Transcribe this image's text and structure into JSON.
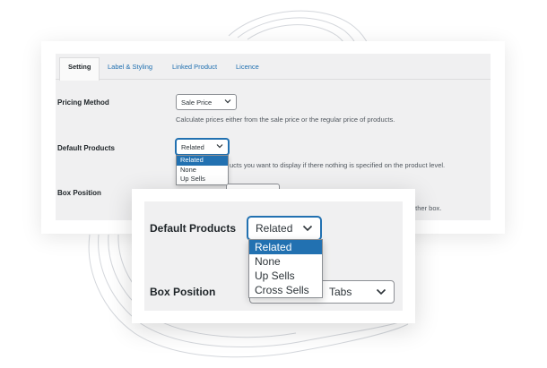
{
  "colors": {
    "accent": "#2271b1",
    "panel_background": "#f0f0f1",
    "decorative_lines": "#d4d7dc"
  },
  "tabs": [
    {
      "label": "Setting",
      "active": true
    },
    {
      "label": "Label & Styling",
      "active": false
    },
    {
      "label": "Linked Product",
      "active": false
    },
    {
      "label": "Licence",
      "active": false
    }
  ],
  "pricing_method": {
    "label": "Pricing Method",
    "selected": "Sale Price",
    "description": "Calculate prices either from the sale price or the regular price of products."
  },
  "default_products": {
    "label": "Default Products",
    "selected": "Related",
    "description_visible": "ucts you want to display if there nothing is specified on the product level.",
    "options_back": [
      "Related",
      "None",
      "Up Sells"
    ],
    "options": [
      "Related",
      "None",
      "Up Sells",
      "Cross Sells"
    ],
    "highlighted": "Related"
  },
  "box_position": {
    "label": "Box Position",
    "description_visible": "other box.",
    "selected_visible": "Tabs"
  },
  "icons": {
    "select_arrow": "chevron-down-icon"
  }
}
